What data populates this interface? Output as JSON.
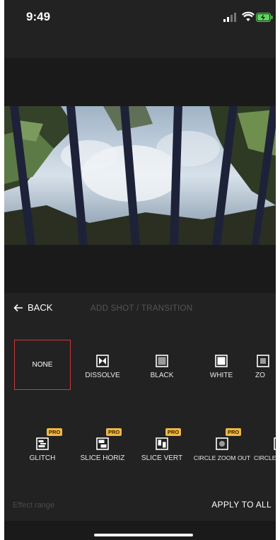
{
  "status_bar": {
    "time": "9:49"
  },
  "header": {
    "back_label": "BACK",
    "title": "ADD SHOT / TRANSITION"
  },
  "transitions_row1": [
    {
      "label": "NONE",
      "selected": true
    },
    {
      "label": "DISSOLVE",
      "icon": "bowtie-icon"
    },
    {
      "label": "BLACK",
      "icon": "gray-square-icon"
    },
    {
      "label": "WHITE",
      "icon": "white-square-icon"
    },
    {
      "label": "ZO",
      "icon": "zoom-icon"
    }
  ],
  "transitions_row2": [
    {
      "label": "GLITCH",
      "badge": "PRO",
      "icon": "glitch-icon"
    },
    {
      "label": "SLICE HORIZ",
      "badge": "PRO",
      "icon": "slice-horiz-icon"
    },
    {
      "label": "SLICE VERT",
      "badge": "PRO",
      "icon": "slice-vert-icon"
    },
    {
      "label": "CIRCLE ZOOM OUT",
      "badge": "PRO",
      "icon": "circle-zoom-out-icon"
    },
    {
      "label": "CIRCLE",
      "icon": "circle-icon"
    }
  ],
  "footer": {
    "effect_range": "Effect range",
    "apply_all": "APPLY TO ALL"
  },
  "colors": {
    "selection_border": "#cc3a3a",
    "pro_badge": "#f0b643",
    "background": "#222222"
  }
}
